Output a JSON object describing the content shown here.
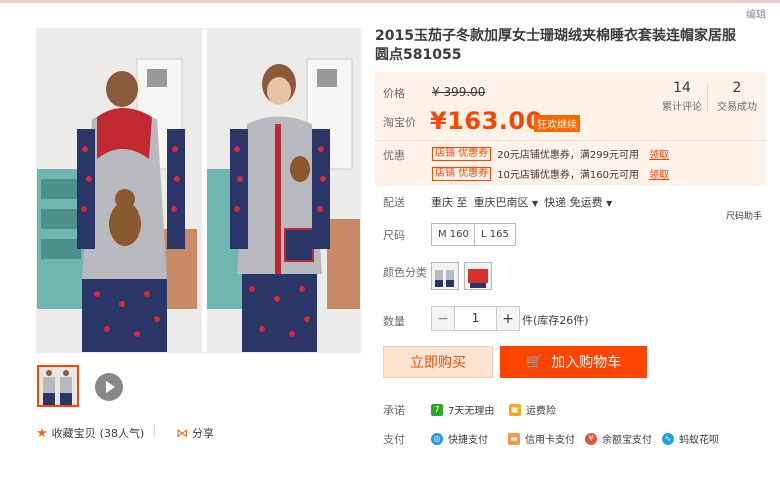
{
  "header": {
    "edit_link": "编辑"
  },
  "gallery": {
    "play_label": "play-video",
    "favorite": {
      "label": "收藏宝贝",
      "count": "(38人气)"
    },
    "share_label": "分享"
  },
  "product": {
    "title": "2015玉茄子冬款加厚女士珊瑚绒夹棉睡衣套装连帽家居服圆点581055",
    "price": {
      "label": "价格",
      "value": "¥ 399.00"
    },
    "promo": {
      "label": "淘宝价",
      "value": "¥163.00",
      "tag": "狂欢继续"
    },
    "stats": [
      {
        "count": "14",
        "label": "累计评论"
      },
      {
        "count": "2",
        "label": "交易成功"
      }
    ],
    "coupons": {
      "label": "优惠",
      "items": [
        {
          "tag": "店铺  优惠券",
          "text": "20元店铺优惠券，满299元可用",
          "action": "领取"
        },
        {
          "tag": "店铺  优惠券",
          "text": "10元店铺优惠券，满160元可用",
          "action": "领取"
        }
      ]
    },
    "delivery": {
      "label": "配送",
      "from": "重庆 至",
      "to": "重庆巴南区",
      "method": "快递 免运费"
    },
    "size_helper": "尺码助手",
    "sizes": {
      "label": "尺码",
      "options": [
        "M 160",
        "L 165"
      ]
    },
    "colors": {
      "label": "颜色分类"
    },
    "quantity": {
      "label": "数量",
      "value": "1",
      "minus": "−",
      "plus": "+",
      "stock": "件(库存26件)"
    },
    "actions": {
      "buy": "立即购买",
      "cart": "加入购物车"
    },
    "promise": {
      "label": "承诺",
      "items": [
        "7天无理由",
        "运费险"
      ]
    },
    "payment": {
      "label": "支付",
      "items": [
        "快捷支付",
        "信用卡支付",
        "余额宝支付",
        "蚂蚁花呗"
      ]
    }
  },
  "colors": {
    "accent": "#ff4400",
    "price": "#ff4400",
    "price_bg": "#fff2e8"
  }
}
